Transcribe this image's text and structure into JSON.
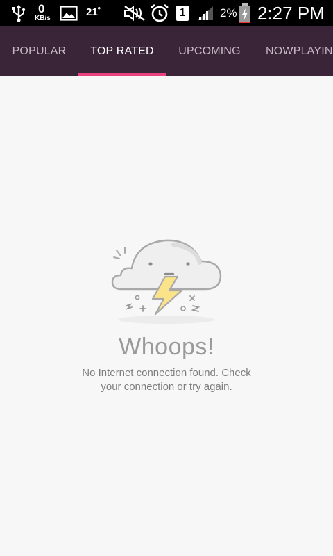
{
  "status_bar": {
    "kb_value": "0",
    "kb_unit": "KB/s",
    "temperature": "21˚",
    "sim_slot": "1",
    "battery_percent": "2%",
    "time": "2:27 PM",
    "icons": [
      "usb-icon",
      "image-icon",
      "mute-icon",
      "alarm-icon",
      "signal-icon",
      "battery-icon"
    ]
  },
  "tabs": [
    {
      "label": "POPULAR",
      "active": false
    },
    {
      "label": "TOP RATED",
      "active": true
    },
    {
      "label": "UPCOMING",
      "active": false
    },
    {
      "label": "NOWPLAYING",
      "active": false
    }
  ],
  "colors": {
    "tab_bar": "#3a2438",
    "tab_indicator": "#e8437f",
    "background": "#f7f7f7",
    "bolt": "#fbe38a"
  },
  "error": {
    "illustration": "storm-cloud-icon",
    "title": "Whoops!",
    "message_line1": "No Internet connection found. Check",
    "message_line2": "your connection or try again."
  }
}
